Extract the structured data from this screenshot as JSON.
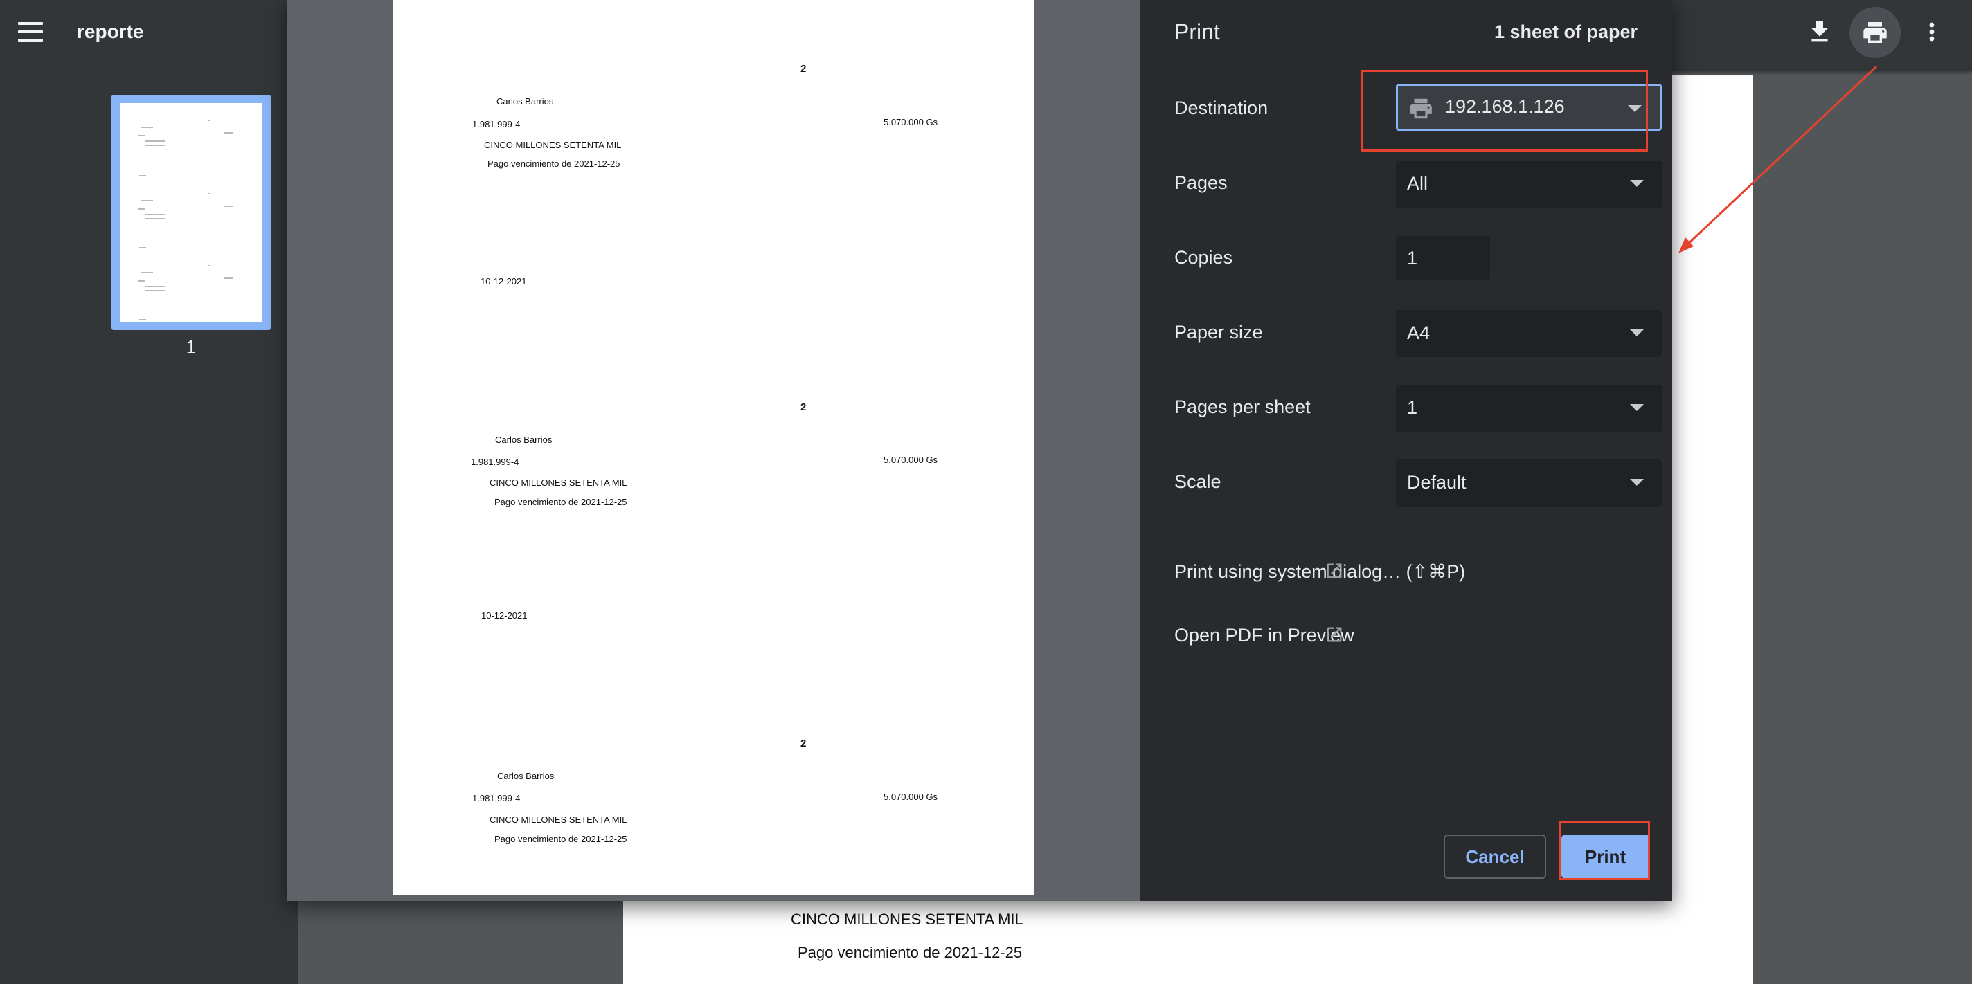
{
  "viewer": {
    "title": "reporte",
    "thumbnail_page_number": "1"
  },
  "background_page": {
    "line1": "CINCO MILLONES SETENTA MIL",
    "line2": "Pago vencimiento de 2021-12-25"
  },
  "preview": {
    "receipts": [
      {
        "number": "2",
        "name": "Carlos Barrios",
        "id": "1.981.999-4",
        "amount": "5.070.000 Gs",
        "words": "CINCO MILLONES SETENTA MIL",
        "concept": "Pago vencimiento de 2021-12-25",
        "date": "10-12-2021"
      },
      {
        "number": "2",
        "name": "Carlos Barrios",
        "id": "1.981.999-4",
        "amount": "5.070.000 Gs",
        "words": "CINCO MILLONES SETENTA MIL",
        "concept": "Pago vencimiento de 2021-12-25",
        "date": "10-12-2021"
      },
      {
        "number": "2",
        "name": "Carlos Barrios",
        "id": "1.981.999-4",
        "amount": "5.070.000 Gs",
        "words": "CINCO MILLONES SETENTA MIL",
        "concept": "Pago vencimiento de 2021-12-25"
      }
    ]
  },
  "print_dialog": {
    "title": "Print",
    "sheet_count": "1 sheet of paper",
    "destination": {
      "label": "Destination",
      "value": "192.168.1.126"
    },
    "pages": {
      "label": "Pages",
      "value": "All"
    },
    "copies": {
      "label": "Copies",
      "value": "1"
    },
    "paper_size": {
      "label": "Paper size",
      "value": "A4"
    },
    "pages_per_sheet": {
      "label": "Pages per sheet",
      "value": "1"
    },
    "scale": {
      "label": "Scale",
      "value": "Default"
    },
    "system_dialog_link": "Print using system dialog… (⇧⌘P)",
    "open_pdf_link": "Open PDF in Preview",
    "cancel_label": "Cancel",
    "print_label": "Print"
  },
  "icons": {
    "menu": "menu-icon",
    "download": "download-icon",
    "print": "print-icon",
    "more": "more-vert-icon",
    "external": "open-external-icon"
  },
  "colors": {
    "accent": "#8ab4f8",
    "annotation": "#e5432d",
    "toolbar": "#323639",
    "dialog_panel": "#292a2d"
  }
}
